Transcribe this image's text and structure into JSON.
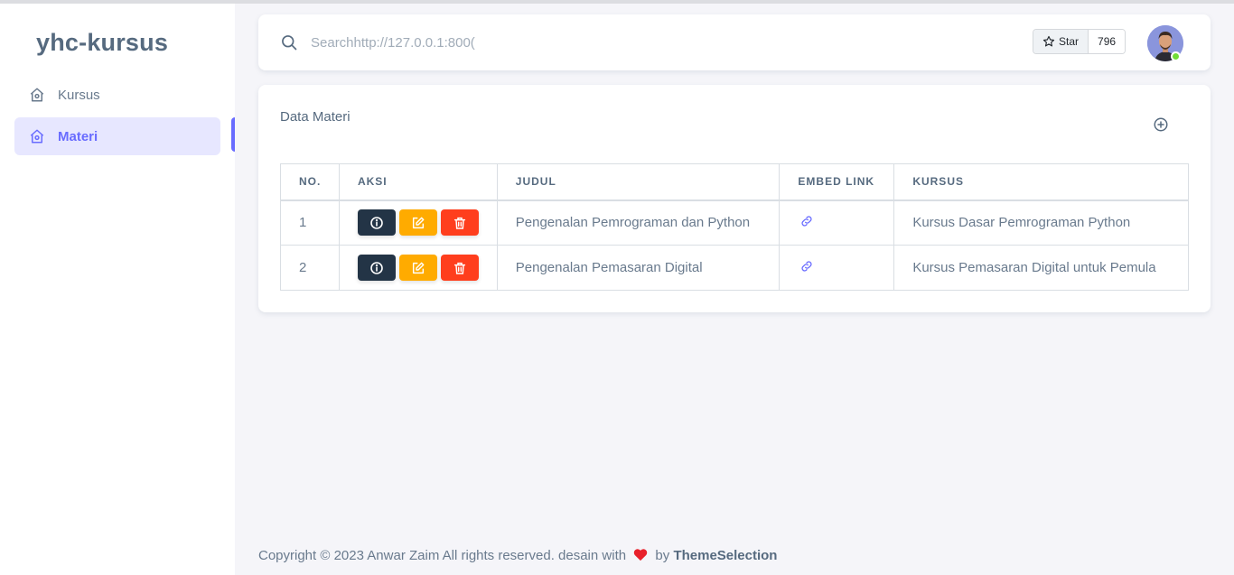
{
  "sidebar": {
    "brand": "yhc-kursus",
    "items": [
      {
        "label": "Kursus",
        "icon": "home-icon"
      },
      {
        "label": "Materi",
        "icon": "home-icon",
        "active": true
      }
    ]
  },
  "navbar": {
    "search_value": "Searchhttp://127.0.0.1:800(",
    "star_label": "Star",
    "star_count": "796"
  },
  "card": {
    "title": "Data Materi",
    "columns": [
      "NO.",
      "AKSI",
      "JUDUL",
      "EMBED LINK",
      "KURSUS"
    ],
    "rows": [
      {
        "no": "1",
        "judul": "Pengenalan Pemrograman dan Python",
        "kursus": "Kursus Dasar Pemrograman Python"
      },
      {
        "no": "2",
        "judul": "Pengenalan Pemasaran Digital",
        "kursus": "Kursus Pemasaran Digital untuk Pemula"
      }
    ]
  },
  "footer": {
    "text": "Copyright © 2023 Anwar Zaim All rights reserved. desain with",
    "by": "by",
    "brand": "ThemeSelection"
  },
  "colors": {
    "primary": "#696cff",
    "info_btn": "#233446",
    "edit_btn": "#ffab00",
    "delete_btn": "#ff3e1d",
    "online": "#71dd37"
  }
}
